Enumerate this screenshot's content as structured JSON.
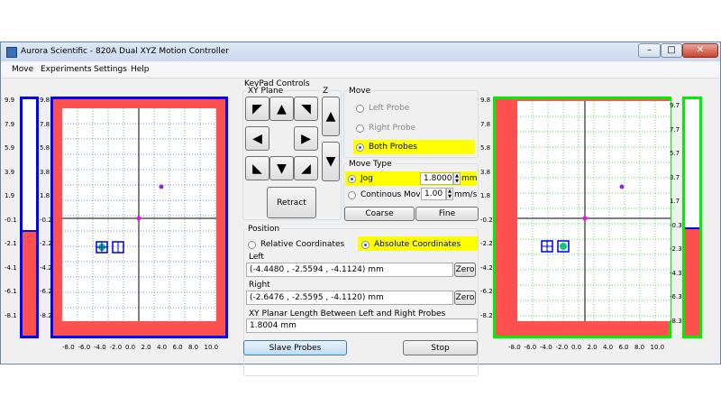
{
  "window": {
    "title": "Aurora Scientific - 820A Dual XYZ Motion Controller",
    "minimize": "–",
    "maximize": "□",
    "close": "✕"
  },
  "menu": {
    "move": "Move",
    "experiments": "Experiments",
    "settings": "Settings",
    "help": "Help"
  },
  "left_plot": {
    "z_ticks": [
      "9.9",
      "7.9",
      "5.9",
      "3.9",
      "1.9",
      "-0.1",
      "-2.1",
      "-4.1",
      "-6.1",
      "-8.1"
    ],
    "y_ticks": [
      "9.8",
      "7.8",
      "5.8",
      "3.8",
      "1.8",
      "-0.2",
      "-2.2",
      "-4.2",
      "-6.2",
      "-8.2"
    ],
    "x_ticks": [
      "-8.0",
      "-6.0",
      "-4.0",
      "-2.0",
      "0.0",
      "2.0",
      "4.0",
      "6.0",
      "8.0",
      "10.0"
    ],
    "z_level_fraction": 0.56,
    "accent": "#0000ff"
  },
  "right_plot": {
    "z_ticks": [
      "9.7",
      "7.7",
      "5.7",
      "3.7",
      "1.7",
      "-0.3",
      "-2.3",
      "-4.3",
      "-6.3",
      "-8.3"
    ],
    "y_ticks": [
      "9.8",
      "7.8",
      "5.8",
      "3.8",
      "1.8",
      "-0.2",
      "-2.2",
      "-4.2",
      "-6.2",
      "-8.2"
    ],
    "x_ticks": [
      "-8.0",
      "-6.0",
      "-4.0",
      "-2.0",
      "0.0",
      "2.0",
      "4.0",
      "6.0",
      "8.0",
      "10.0"
    ],
    "z_level_fraction": 0.55,
    "accent": "#00ee00"
  },
  "keypad": {
    "title": "KeyPad Controls",
    "xy_plane": "XY Plane",
    "z": "Z",
    "retract": "Retract",
    "arrows": {
      "up_left": "◤",
      "up": "▲",
      "up_right": "◥",
      "left": "◀",
      "right": "▶",
      "down_left": "◣",
      "down": "▼",
      "down_right": "◢",
      "z_up": "▲",
      "z_down": "▼"
    }
  },
  "move": {
    "title": "Move",
    "left_probe": "Left Probe",
    "right_probe": "Right Probe",
    "both_probes": "Both Probes"
  },
  "move_type": {
    "title": "Move Type",
    "jog": "Jog",
    "jog_value": "1.8000",
    "jog_unit": "mm",
    "continuous": "Continous Move",
    "cont_value": "1.00",
    "cont_unit": "mm/s",
    "coarse": "Coarse",
    "fine": "Fine"
  },
  "position": {
    "title": "Position",
    "relative": "Relative Coordinates",
    "absolute": "Absolute Coordinates",
    "left_label": "Left",
    "left_value": "(-4.4480 , -2.5594 , -4.1124) mm",
    "right_label": "Right",
    "right_value": "(-2.6476 , -2.5595 , -4.1120) mm",
    "zero": "Zero",
    "planar_label": "XY Planar Length Between Left and Right Probes",
    "planar_value": "1.8004 mm"
  },
  "bottom": {
    "slave": "Slave Probes",
    "stop": "Stop"
  },
  "colors": {
    "highlight": "#ffff00",
    "red": "#ff5050",
    "magenta": "#ff00ff",
    "purple": "#8a2be2"
  }
}
